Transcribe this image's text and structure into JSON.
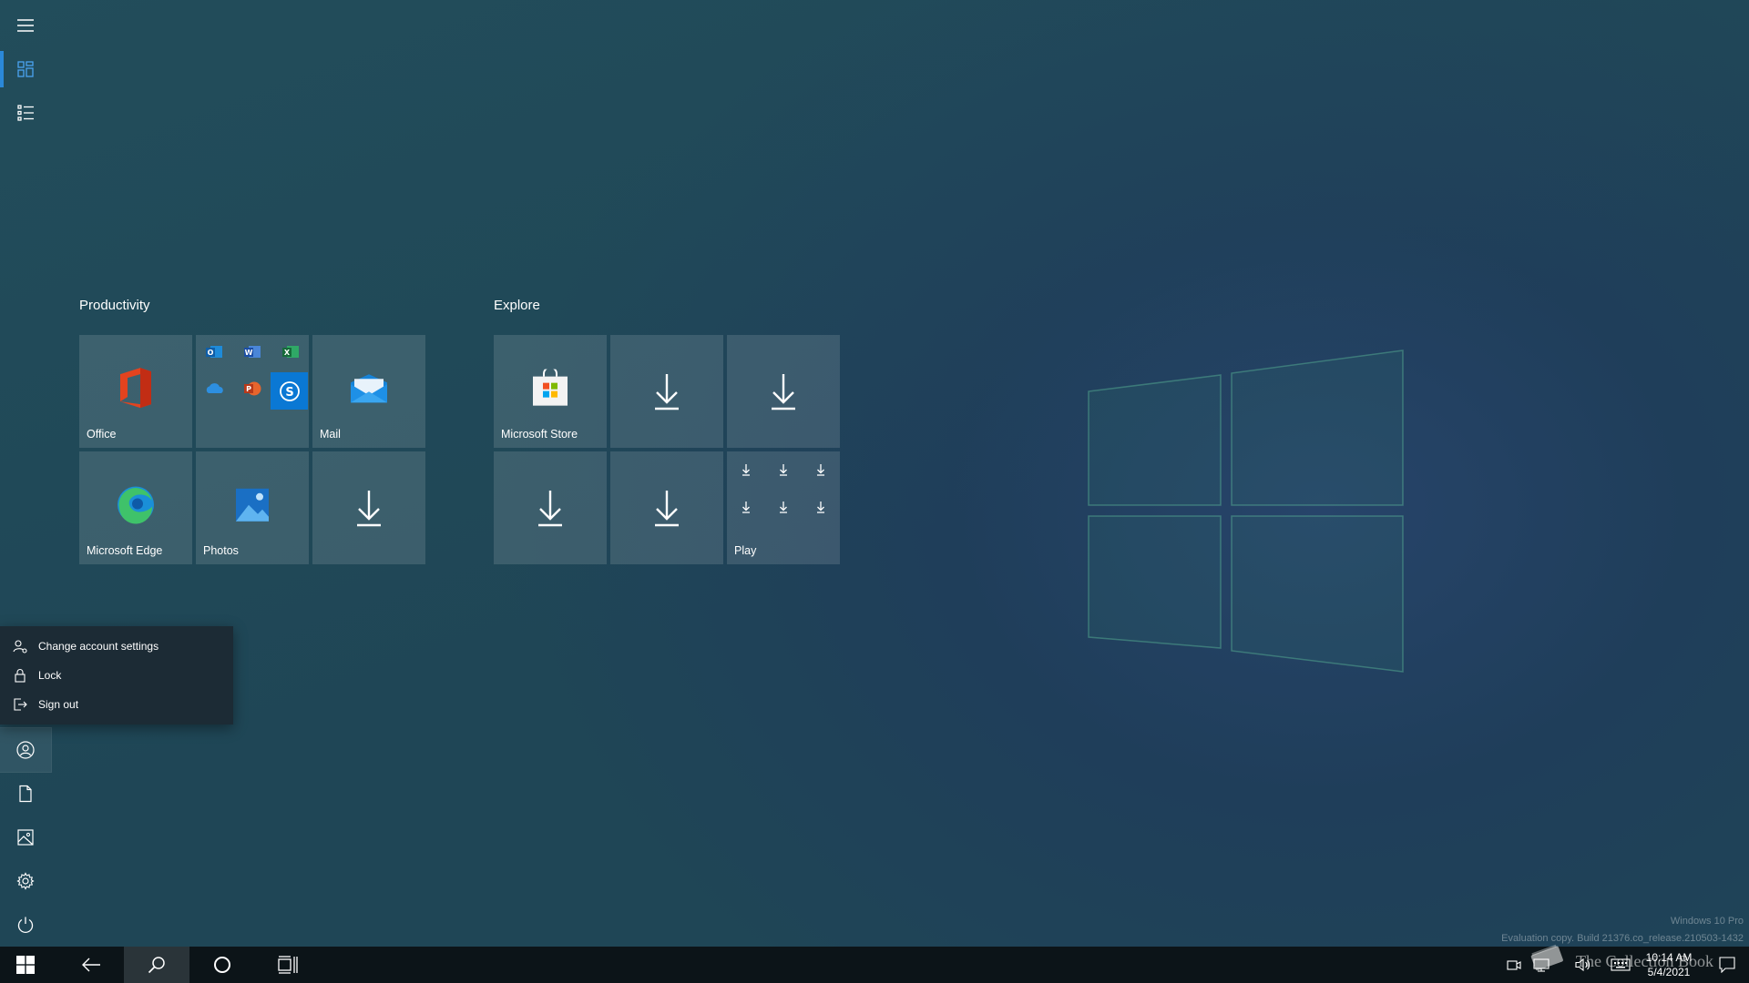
{
  "groups": [
    {
      "title": "Productivity",
      "tiles": [
        {
          "label": "Office",
          "icon": "office-icon"
        },
        {
          "label": "",
          "icon": "office-apps-folder-icon"
        },
        {
          "label": "Mail",
          "icon": "mail-icon"
        },
        {
          "label": "Microsoft Edge",
          "icon": "edge-icon"
        },
        {
          "label": "Photos",
          "icon": "photos-icon"
        },
        {
          "label": "",
          "icon": "download-icon"
        }
      ]
    },
    {
      "title": "Explore",
      "tiles": [
        {
          "label": "Microsoft Store",
          "icon": "store-icon"
        },
        {
          "label": "",
          "icon": "download-icon"
        },
        {
          "label": "",
          "icon": "download-icon"
        },
        {
          "label": "",
          "icon": "download-icon"
        },
        {
          "label": "",
          "icon": "download-icon"
        },
        {
          "label": "Play",
          "icon": "play-folder-icon"
        }
      ]
    }
  ],
  "account_menu": {
    "change_settings": "Change account settings",
    "lock": "Lock",
    "sign_out": "Sign out"
  },
  "taskbar": {
    "time": "10:14 AM",
    "date": "5/4/2021"
  },
  "watermark": {
    "edition": "Windows 10 Pro",
    "build": "Evaluation copy. Build 21376.co_release.210503-1432",
    "overlay": "The Collection Book"
  },
  "colors": {
    "accent": "#2b88d8",
    "taskbar": "#0c1418",
    "tile": "rgba(255,255,255,0.13)"
  }
}
